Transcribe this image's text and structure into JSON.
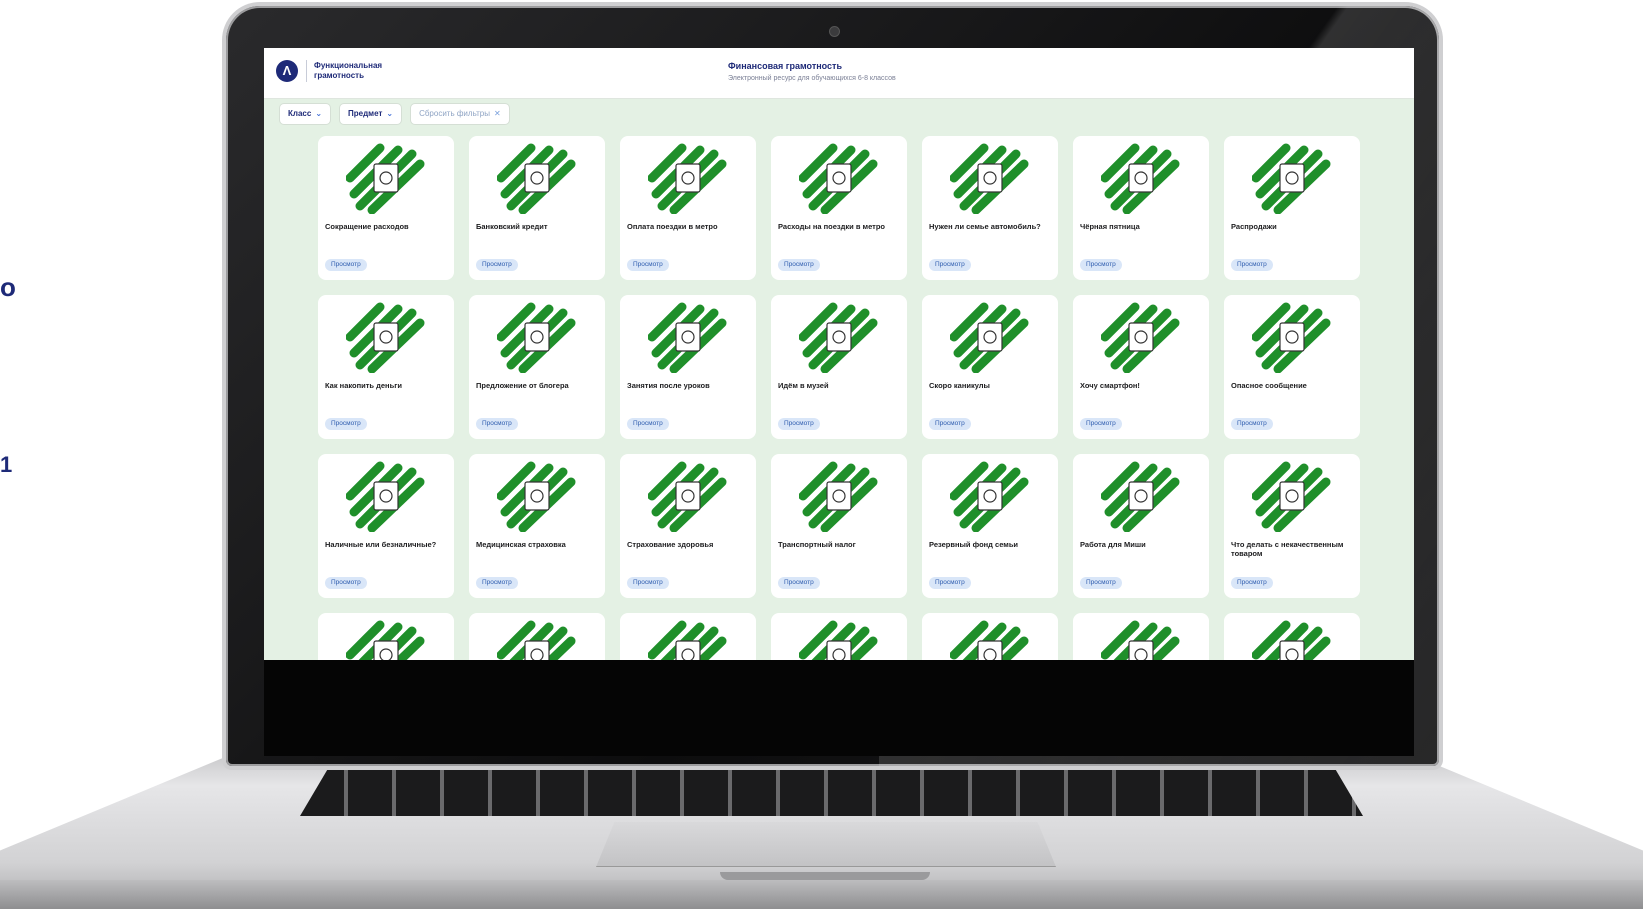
{
  "edge_text": {
    "line1": "о",
    "line2": "1"
  },
  "header": {
    "brand": "Функциональная грамотность",
    "course_title": "Финансовая грамотность",
    "course_subtitle": "Электронный ресурс для обучающихся 6-8 классов"
  },
  "filters": {
    "class_label": "Класс",
    "subject_label": "Предмет",
    "reset_label": "Сбросить фильтры"
  },
  "card_button_label": "Просмотр",
  "cards": [
    "Сокращение расходов",
    "Банковский кредит",
    "Оплата поездки в метро",
    "Расходы на поездки в метро",
    "Нужен ли семье автомобиль?",
    "Чёрная пятница",
    "Распродажи",
    "Как накопить деньги",
    "Предложение от блогера",
    "Занятия после уроков",
    "Идём в музей",
    "Скоро каникулы",
    "Хочу смартфон!",
    "Опасное сообщение",
    "Наличные или безналичные?",
    "Медицинская страховка",
    "Страхование здоровья",
    "Транспортный налог",
    "Резервный фонд семьи",
    "Работа для Миши",
    "Что делать с некачественным товаром",
    "",
    "",
    "",
    "",
    "",
    "",
    ""
  ],
  "colors": {
    "accent_green": "#1f8f2a",
    "brand_blue": "#1e2a78",
    "page_bg": "#e4f1e4"
  }
}
